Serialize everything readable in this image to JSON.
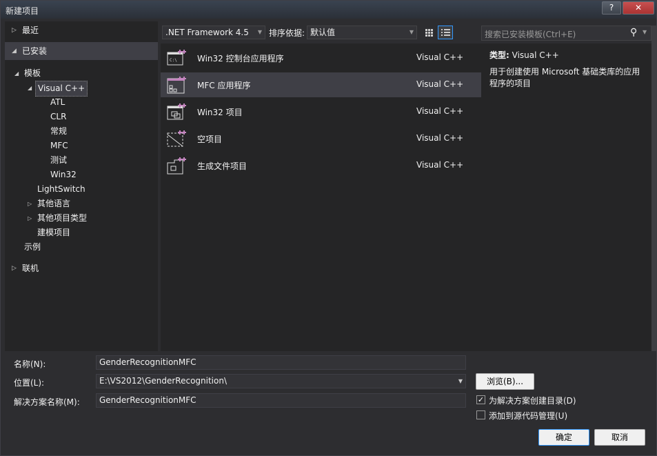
{
  "window": {
    "title": "新建项目",
    "help_label": "?",
    "close_label": "✕"
  },
  "left": {
    "recent": "最近",
    "installed": "已安装",
    "tree": [
      {
        "label": "模板",
        "level": 1,
        "expanded": true
      },
      {
        "label": "Visual C++",
        "level": 2,
        "expanded": true,
        "selected": true
      },
      {
        "label": "ATL",
        "level": 3
      },
      {
        "label": "CLR",
        "level": 3
      },
      {
        "label": "常规",
        "level": 3
      },
      {
        "label": "MFC",
        "level": 3
      },
      {
        "label": "测试",
        "level": 3
      },
      {
        "label": "Win32",
        "level": 3
      },
      {
        "label": "LightSwitch",
        "level": 2
      },
      {
        "label": "其他语言",
        "level": 2,
        "collapsed": true
      },
      {
        "label": "其他项目类型",
        "level": 2,
        "collapsed": true
      },
      {
        "label": "建模项目",
        "level": 2
      },
      {
        "label": "示例",
        "level": 1
      }
    ],
    "online": "联机"
  },
  "toolbar": {
    "framework": ".NET Framework 4.5",
    "sort_label": "排序依据:",
    "sort_value": "默认值"
  },
  "templates": [
    {
      "name": "Win32 控制台应用程序",
      "lang": "Visual C++",
      "icon": "console-app-icon"
    },
    {
      "name": "MFC 应用程序",
      "lang": "Visual C++",
      "icon": "mfc-app-icon",
      "selected": true
    },
    {
      "name": "Win32 项目",
      "lang": "Visual C++",
      "icon": "win32-project-icon"
    },
    {
      "name": "空项目",
      "lang": "Visual C++",
      "icon": "empty-project-icon"
    },
    {
      "name": "生成文件项目",
      "lang": "Visual C++",
      "icon": "makefile-project-icon"
    }
  ],
  "search": {
    "placeholder": "搜索已安装模板(Ctrl+E)"
  },
  "details": {
    "type_label": "类型:",
    "type_value": "Visual C++",
    "description": "用于创建使用 Microsoft 基础类库的应用程序的项目"
  },
  "form": {
    "name_label": "名称(N):",
    "name_value": "GenderRecognitionMFC",
    "location_label": "位置(L):",
    "location_value": "E:\\VS2012\\GenderRecognition\\",
    "solution_label": "解决方案名称(M):",
    "solution_value": "GenderRecognitionMFC",
    "browse_label": "浏览(B)...",
    "create_dir_label": "为解决方案创建目录(D)",
    "create_dir_checked": true,
    "source_control_label": "添加到源代码管理(U)",
    "source_control_checked": false,
    "ok_label": "确定",
    "cancel_label": "取消"
  },
  "colors": {
    "accent": "#3399ff",
    "icon": "#c586c0"
  }
}
